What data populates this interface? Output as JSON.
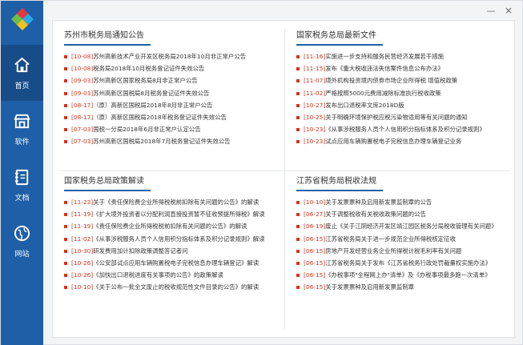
{
  "window": {
    "minimize_icon": "minimize-icon",
    "close_icon": "close-icon",
    "minimize": "—",
    "close": "×"
  },
  "sidebar": {
    "accent": "#1e5fa8",
    "items": [
      {
        "label": "首页",
        "icon": "home-icon"
      },
      {
        "label": "软件",
        "icon": "store-icon"
      },
      {
        "label": "文档",
        "icon": "document-icon"
      },
      {
        "label": "网站",
        "icon": "globe-icon"
      }
    ]
  },
  "panels": {
    "suzhou": {
      "title": "苏州市税务局通知公告",
      "items": [
        {
          "date": "[10-08]",
          "text": "苏州高新技术产业开发区税务局2018年10月非正常户公告"
        },
        {
          "date": "[10-08]",
          "text": "税务局2018年10月税务登记证件失效公告"
        },
        {
          "date": "[09-03]",
          "text": "苏州高新区国家税务局8月非正常户公告"
        },
        {
          "date": "[09-03]",
          "text": "苏州高新区国税局8月税务登记证件失效公告"
        },
        {
          "date": "[08-17]",
          "text": "（原）高新区国税局2018年8月非正常户公告"
        },
        {
          "date": "[08-17]",
          "text": "（原）高新区国税局2018年税务登记证件失效公告"
        },
        {
          "date": "[07-03]",
          "text": "国税一分局2018年6月非正常户认定公告"
        },
        {
          "date": "[07-03]",
          "text": "苏州高新区国税局2018年7月税务登记证件失效公告"
        }
      ]
    },
    "national_docs": {
      "title": "国家税务总局最新文件",
      "items": [
        {
          "date": "[11-16]",
          "text": "实施进一步支持和服务民营经济发展若干措施"
        },
        {
          "date": "[11-15]",
          "text": "发布《重大税收违法失信案件信息公布办法》"
        },
        {
          "date": "[11-07]",
          "text": "境外机构投资境内债券市场企业所得税 增值税政策"
        },
        {
          "date": "[11-02]",
          "text": "严格按照5000元费用减除标准执行税收政策"
        },
        {
          "date": "[10-27]",
          "text": "发布出口退税率文库2018D版"
        },
        {
          "date": "[10-25]",
          "text": "关于明确环境保护税应税污染物适用等有关问题的通知"
        },
        {
          "date": "[10-23]",
          "text": "《从事涉税服务人员个人信用积分指标体系及积分记录规则》"
        },
        {
          "date": "[10-23]",
          "text": "试点应用车辆购置税电子完税信息办理车辆登记业务"
        }
      ]
    },
    "national_interp": {
      "title": "国家税务总局政策解读",
      "items": [
        {
          "date": "[11-23]",
          "text": "关于《责任保险费企业所得税税前扣除有关问题的公告》的解读"
        },
        {
          "date": "[11-19]",
          "text": "《扩大境外投资者以分配利润直接投资暂不征收预提所得税》解读"
        },
        {
          "date": "[11-19]",
          "text": "《责任保险费企业所得税税前扣除有关问题的公告》的解读"
        },
        {
          "date": "[11-02]",
          "text": "《从事涉税服务人员个人信用积分指标体系及积分记录规则》解读"
        },
        {
          "date": "[10-30]",
          "text": "研发费用加计扣除政策调整答记者问"
        },
        {
          "date": "[10-26]",
          "text": "《公安部试点应用车辆购置税电子完税信息办理车辆登记》解读"
        },
        {
          "date": "[10-26]",
          "text": "《加快出口退税进度有关事项的公告》的政策解读"
        },
        {
          "date": "[10-10]",
          "text": "《关于公布一批全文废止的税收规范性文件目录的公告》的解读"
        }
      ]
    },
    "jiangsu": {
      "title": "江苏省税务局税收法规",
      "items": [
        {
          "date": "[10-10]",
          "text": "关于发票票种及启用新发票监制章的公告"
        },
        {
          "date": "[06-27]",
          "text": "关于调整税收有关税收政策问题的公告"
        },
        {
          "date": "[06-19]",
          "text": "废止《关于江阴经济开发区靖江园区税务分局税收管理有关问题》"
        },
        {
          "date": "[06-15]",
          "text": "江苏省税务局关于进一步规范企业所得税核定征收"
        },
        {
          "date": "[06-15]",
          "text": "房地产开发经营业务企业所得税计税毛利率有关问题"
        },
        {
          "date": "[06-15]",
          "text": "江苏省税务局关于发布《江苏省税务行政处罚裁量权实施办法》"
        },
        {
          "date": "[06-15]",
          "text": "《办税事项\"全程网上办\"清单》及《办税事项最多跑一次清单》"
        },
        {
          "date": "[06-15]",
          "text": "关于发票票种及启用新发票监制章"
        }
      ]
    }
  }
}
